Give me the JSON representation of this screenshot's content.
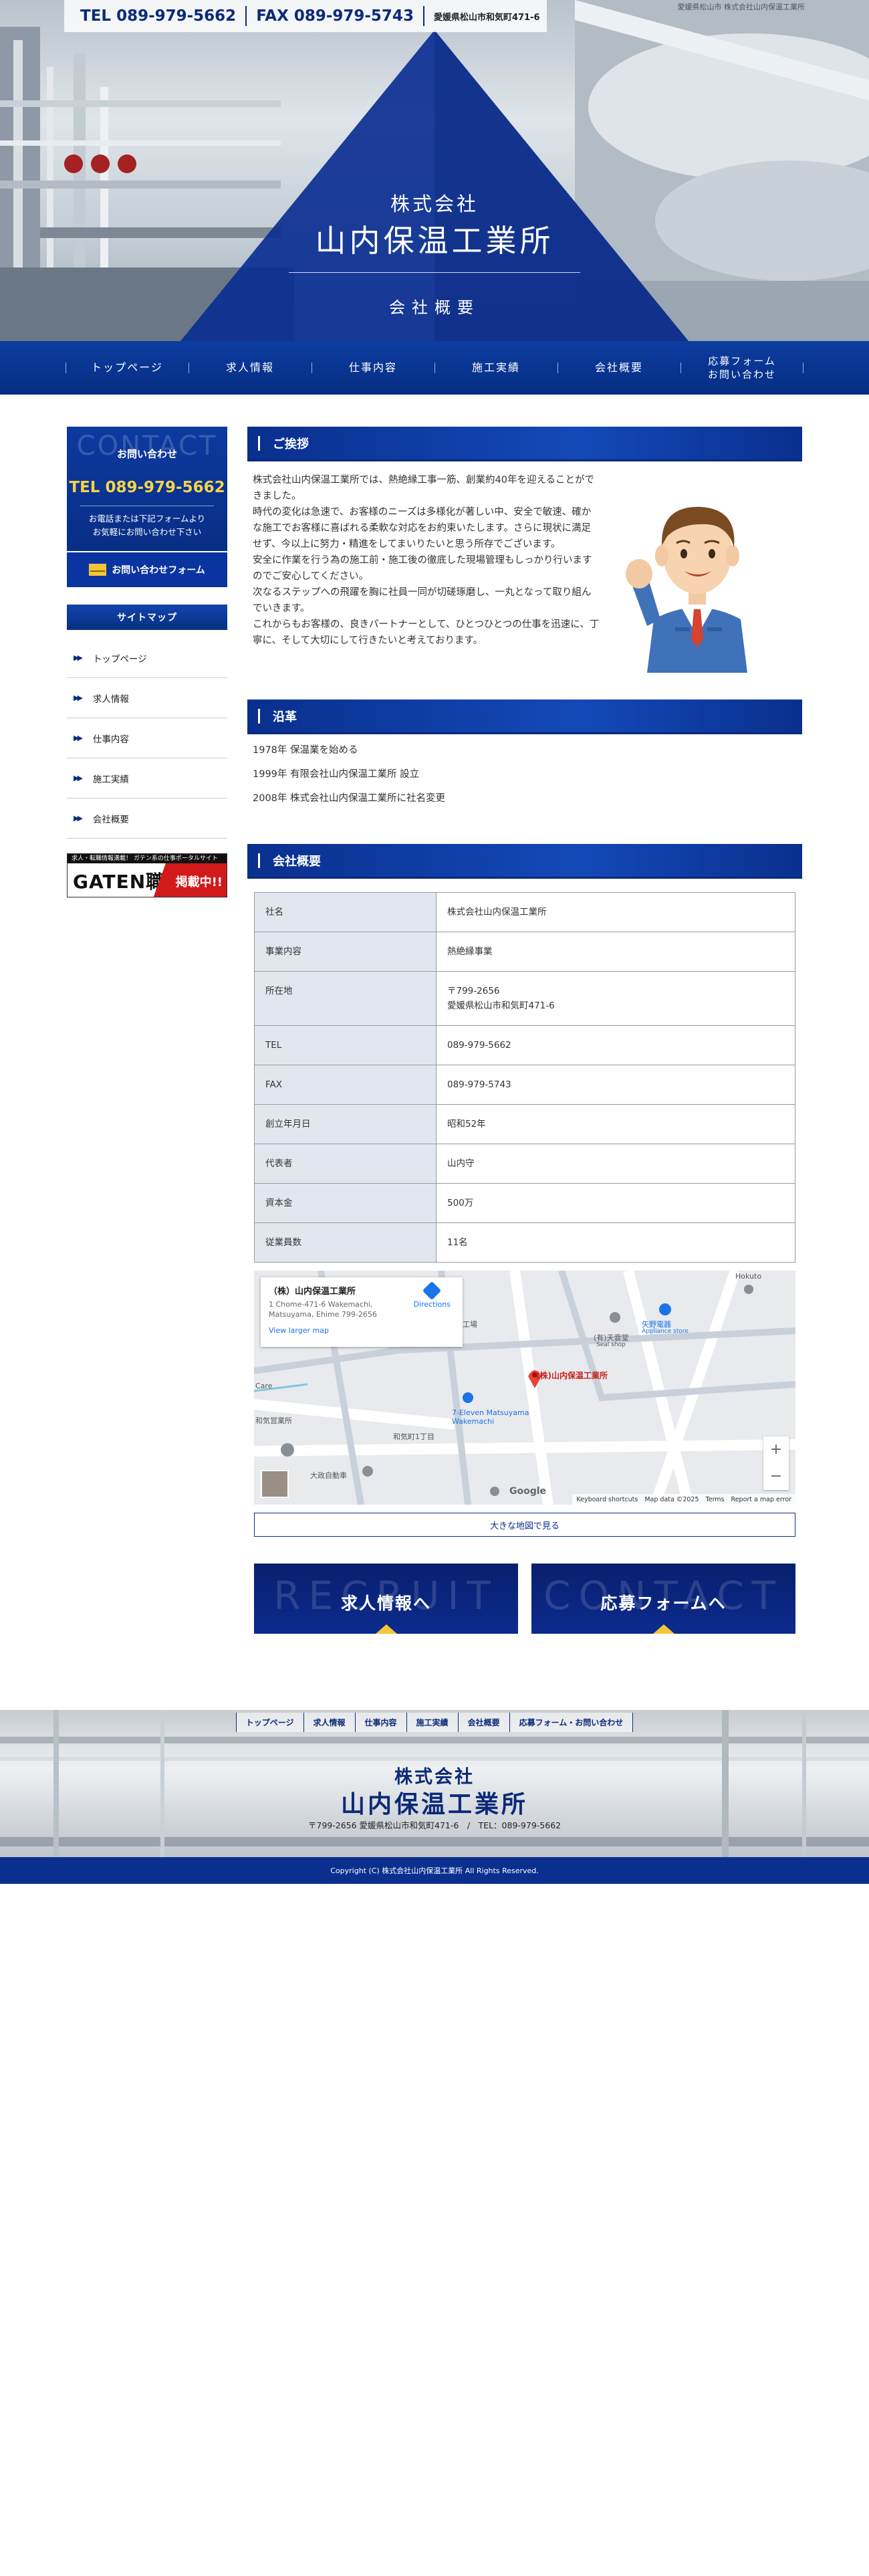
{
  "header": {
    "tel": "TEL 089-979-5662",
    "fax": "FAX 089-979-5743",
    "address": "愛媛県松山市和気町471-6",
    "tagline": "愛媛県松山市 株式会社山内保温工業所",
    "company_prefix": "株式会社",
    "company_name": "山内保温工業所",
    "page_title": "会社概要"
  },
  "nav": {
    "items": [
      {
        "label": "トップページ"
      },
      {
        "label": "求人情報"
      },
      {
        "label": "仕事内容"
      },
      {
        "label": "施工実績"
      },
      {
        "label": "会社概要"
      },
      {
        "label": "応募フォーム\nお問い合わせ"
      }
    ]
  },
  "sidebar": {
    "contact": {
      "bg_word": "CONTACT",
      "title": "お問い合わせ",
      "tel": "TEL 089-979-5662",
      "note": "お電話または下記フォームより\nお気軽にお問い合わせ下さい",
      "button": "お問い合わせフォーム"
    },
    "sitemap_title": "サイトマップ",
    "sitemap": [
      {
        "label": "トップページ"
      },
      {
        "label": "求人情報"
      },
      {
        "label": "仕事内容"
      },
      {
        "label": "施工実績"
      },
      {
        "label": "会社概要"
      }
    ],
    "gaten": {
      "top": "求人・転職情報満載！ ガテン系の仕事ポータルサイト",
      "logo": "GATEN職",
      "badge": "掲載中!!"
    }
  },
  "greeting": {
    "title": "ご挨拶",
    "text": "株式会社山内保温工業所では、熱絶縁工事一筋、創業約40年を迎えることができました。\n時代の変化は急速で、お客様のニーズは多様化が著しい中、安全で敏速、確かな施工でお客様に喜ばれる柔軟な対応をお約束いたします。さらに現状に満足せず、今以上に努力・精進をしてまいりたいと思う所存でございます。\n安全に作業を行う為の施工前・施工後の徹底した現場管理もしっかり行いますのでご安心してください。\n次なるステップへの飛躍を胸に社員一同が切磋琢磨し、一丸となって取り組んでいきます。\nこれからもお客様の、良きパートナーとして、ひとつひとつの仕事を迅速に、丁寧に、そして大切にして行きたいと考えております。"
  },
  "history": {
    "title": "沿革",
    "items": [
      "1978年 保温業を始める",
      "1999年 有限会社山内保温工業所 設立",
      "2008年 株式会社山内保温工業所に社名変更"
    ]
  },
  "company": {
    "title": "会社概要",
    "rows": [
      {
        "label": "社名",
        "value": "株式会社山内保温工業所"
      },
      {
        "label": "事業内容",
        "value": "熱絶縁事業"
      },
      {
        "label": "所在地",
        "value": "〒799-2656\n愛媛県松山市和気町471-6"
      },
      {
        "label": "TEL",
        "value": "089-979-5662"
      },
      {
        "label": "FAX",
        "value": "089-979-5743"
      },
      {
        "label": "創立年月日",
        "value": "昭和52年"
      },
      {
        "label": "代表者",
        "value": "山内守"
      },
      {
        "label": "資本金",
        "value": "500万"
      },
      {
        "label": "従業員数",
        "value": "11名"
      }
    ]
  },
  "map": {
    "place_name": "（株）山内保温工業所",
    "place_address": "1 Chome-471-6 Wakemachi,\nMatsuyama, Ehime 799-2656",
    "directions": "Directions",
    "view_larger": "View larger map",
    "pin_label": "(株)山内保温工業所",
    "labels": [
      "矢野電器",
      "Appliance store",
      "(有)天雲堂",
      "Seal shop",
      "7-Eleven Matsuyama Wakemachi",
      "和気町1丁目",
      "大政自動車",
      "Hokuto",
      "工場",
      "Care",
      "和気営業所"
    ],
    "footer": [
      "Keyboard shortcuts",
      "Map data ©2025",
      "Terms",
      "Report a map error"
    ],
    "google": "Google",
    "big_map_button": "大きな地図で見る"
  },
  "banners": {
    "recruit_bg": "RECRUIT",
    "recruit": "求人情報へ",
    "contact_bg": "CONTACT",
    "contact": "応募フォームへ"
  },
  "footer": {
    "nav": [
      "トップページ",
      "求人情報",
      "仕事内容",
      "施工実績",
      "会社概要",
      "応募フォーム・お問い合わせ"
    ],
    "company_prefix": "株式会社",
    "company_name": "山内保温工業所",
    "address": "〒799-2656 愛媛県松山市和気町471-6　/　TEL：089-979-5662",
    "copyright": "Copyright (C) 株式会社山内保温工業所 All Rights Reserved."
  },
  "colors": {
    "navy": "#0a2f8e",
    "accent_yellow": "#f3c537",
    "pin_red": "#c5221f"
  }
}
